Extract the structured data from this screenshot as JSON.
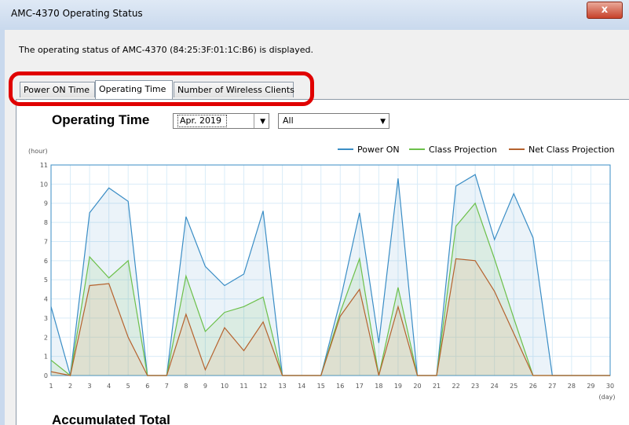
{
  "window": {
    "title": "AMC-4370 Operating Status",
    "close_label": "x"
  },
  "description": "The operating status of AMC-4370 (84:25:3F:01:1C:B6) is displayed.",
  "tabs": [
    {
      "label": "Power ON Time",
      "active": false
    },
    {
      "label": "Operating Time",
      "active": true
    },
    {
      "label": "Number of Wireless Clients",
      "active": false
    }
  ],
  "section_title": "Operating Time",
  "month_select": {
    "value": "Apr. 2019"
  },
  "filter_select": {
    "value": "All"
  },
  "accumulated_title": "Accumulated Total",
  "colors": {
    "power_on": "#3a8dc5",
    "class_projection": "#6cc04a",
    "net_class_projection": "#b5622e",
    "grid": "#d9ecf8",
    "highlight": "#e00000"
  },
  "chart_data": {
    "type": "area",
    "ylabel": "(hour)",
    "xlabel": "(day)",
    "ylim": [
      0,
      11
    ],
    "xlim": [
      1,
      30
    ],
    "y_ticks": [
      0,
      1,
      2,
      3,
      4,
      5,
      6,
      7,
      8,
      9,
      10,
      11
    ],
    "x": [
      1,
      2,
      3,
      4,
      5,
      6,
      7,
      8,
      9,
      10,
      11,
      12,
      13,
      14,
      15,
      16,
      17,
      18,
      19,
      20,
      21,
      22,
      23,
      24,
      25,
      26,
      27,
      28,
      29,
      30
    ],
    "legend_position": "top-right",
    "grid": true,
    "series": [
      {
        "name": "Power ON",
        "values": [
          3.6,
          0,
          8.5,
          9.8,
          9.1,
          0,
          0,
          8.3,
          5.7,
          4.7,
          5.3,
          8.6,
          0,
          0,
          0,
          3.9,
          8.5,
          1.7,
          10.3,
          0,
          0,
          9.9,
          10.5,
          7.1,
          9.5,
          7.2,
          0,
          0,
          0,
          0
        ]
      },
      {
        "name": "Class Projection",
        "values": [
          0.8,
          0,
          6.2,
          5.1,
          6.0,
          0,
          0,
          5.2,
          2.3,
          3.3,
          3.6,
          4.1,
          0,
          0,
          0,
          3.3,
          6.1,
          0,
          4.6,
          0,
          0,
          7.8,
          9.0,
          6.1,
          3.0,
          0,
          0,
          0,
          0,
          0
        ]
      },
      {
        "name": "Net Class Projection",
        "values": [
          0.2,
          0,
          4.7,
          4.8,
          2.0,
          0,
          0,
          3.2,
          0.3,
          2.5,
          1.3,
          2.8,
          0,
          0,
          0,
          3.1,
          4.5,
          0,
          3.6,
          0,
          0,
          6.1,
          6.0,
          4.4,
          2.2,
          0,
          0,
          0,
          0,
          0
        ]
      }
    ]
  }
}
